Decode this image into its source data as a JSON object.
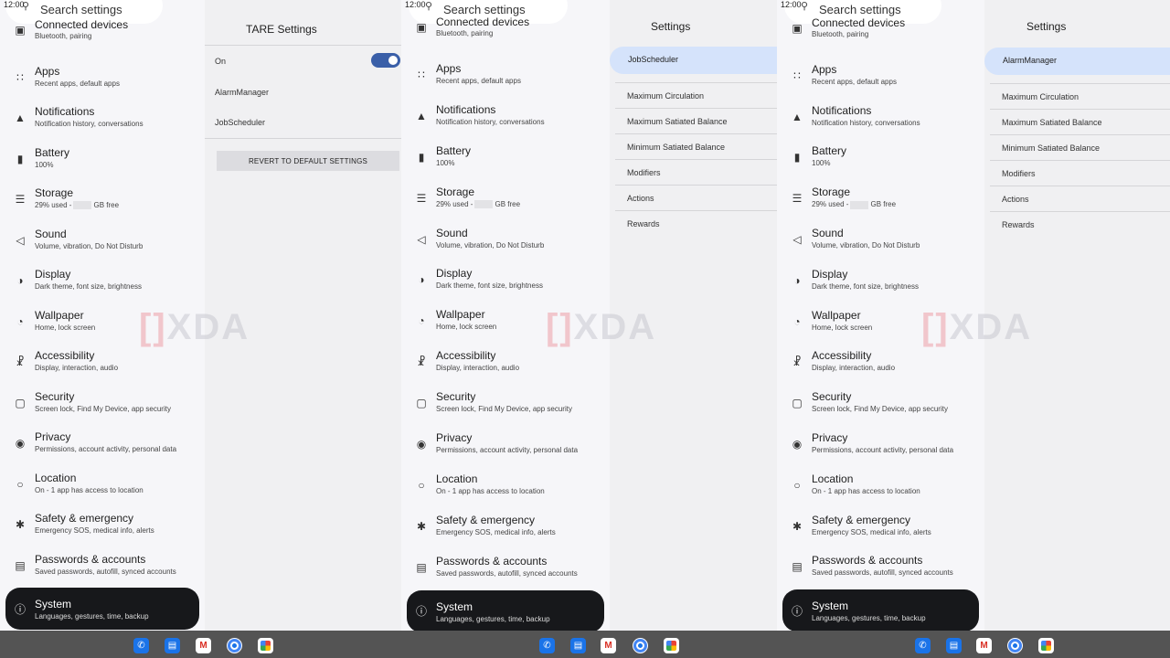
{
  "status": {
    "time": "12:00"
  },
  "search": {
    "placeholder": "Search settings"
  },
  "settings_items": [
    {
      "title": "Connected devices",
      "sub": "Bluetooth, pairing",
      "icon": "devices-icon"
    },
    {
      "title": "Apps",
      "sub": "Recent apps, default apps",
      "icon": "apps-grid-icon"
    },
    {
      "title": "Notifications",
      "sub": "Notification history, conversations",
      "icon": "bell-icon"
    },
    {
      "title": "Battery",
      "sub": "100%",
      "icon": "battery-icon"
    },
    {
      "title": "Storage",
      "sub_a": "29% used -",
      "sub_b": "GB free",
      "icon": "storage-icon"
    },
    {
      "title": "Sound",
      "sub": "Volume, vibration, Do Not Disturb",
      "icon": "speaker-icon"
    },
    {
      "title": "Display",
      "sub": "Dark theme, font size, brightness",
      "icon": "brightness-icon"
    },
    {
      "title": "Wallpaper",
      "sub": "Home, lock screen",
      "icon": "palette-icon"
    },
    {
      "title": "Accessibility",
      "sub": "Display, interaction, audio",
      "icon": "accessibility-icon"
    },
    {
      "title": "Security",
      "sub": "Screen lock, Find My Device, app security",
      "icon": "lock-icon"
    },
    {
      "title": "Privacy",
      "sub": "Permissions, account activity, personal data",
      "icon": "eye-icon"
    },
    {
      "title": "Location",
      "sub": "On - 1 app has access to location",
      "icon": "location-pin-icon"
    },
    {
      "title": "Safety & emergency",
      "sub": "Emergency SOS, medical info, alerts",
      "icon": "asterisk-icon"
    },
    {
      "title": "Passwords & accounts",
      "sub": "Saved passwords, autofill, synced accounts",
      "icon": "account-box-icon"
    },
    {
      "title": "System",
      "sub": "Languages, gestures, time, backup",
      "icon": "info-icon"
    }
  ],
  "panel1": {
    "title": "TARE Settings",
    "toggle_label": "On",
    "toggle_on": true,
    "rows": [
      "AlarmManager",
      "JobScheduler"
    ],
    "reset_button": "REVERT TO DEFAULT SETTINGS"
  },
  "panel2": {
    "title": "Settings",
    "selected": "JobScheduler",
    "rows": [
      "Maximum Circulation",
      "Maximum Satiated Balance",
      "Minimum Satiated Balance",
      "Modifiers",
      "Actions",
      "Rewards"
    ]
  },
  "panel3": {
    "title": "Settings",
    "selected": "AlarmManager",
    "rows": [
      "Maximum Circulation",
      "Maximum Satiated Balance",
      "Minimum Satiated Balance",
      "Modifiers",
      "Actions",
      "Rewards"
    ]
  },
  "watermark": {
    "bracket": "[]",
    "text": "XDA"
  },
  "taskbar_apps": [
    "phone-icon",
    "messages-icon",
    "gmail-icon",
    "chrome-icon",
    "photos-icon"
  ],
  "colors": {
    "toggle": "#3a5fa8",
    "highlight": "#d5e3fb",
    "selected_item": "#17181b",
    "taskbar": "#545454"
  }
}
